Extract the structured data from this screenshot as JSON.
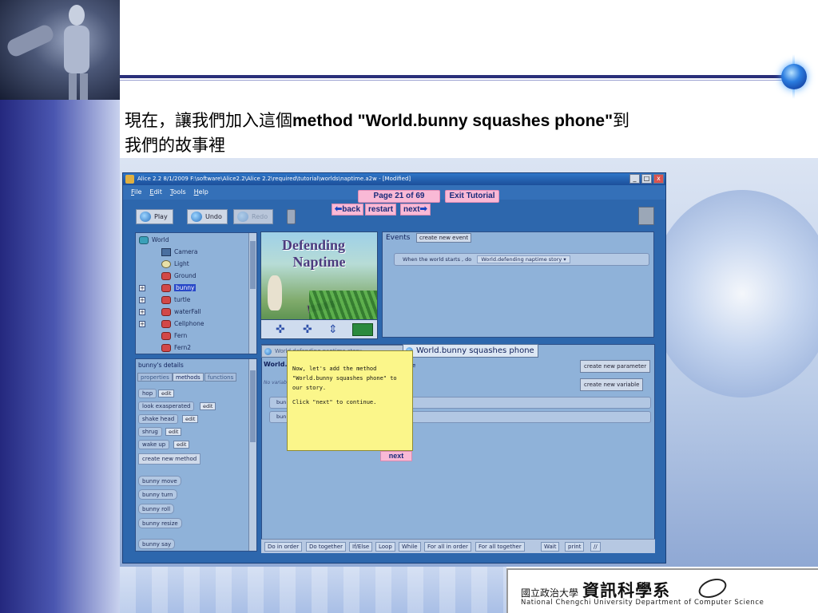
{
  "slide": {
    "title_zh_prefix": "現在，讓我們加入這個",
    "title_en": "method \"World.bunny squashes phone\"",
    "title_zh_suffix": "到",
    "title_line2": "我們的故事裡"
  },
  "logo": {
    "small": "國立政治大學",
    "big": "資訊科學系",
    "english": "National Chengchi University Department of Computer Science"
  },
  "window": {
    "title": "Alice 2.2 8/1/2009 F:\\software\\Alice2.2\\Alice 2.2\\required\\tutorial\\worlds\\naptime.a2w - [Modified]",
    "controls": [
      "_",
      "□",
      "x"
    ]
  },
  "menu": [
    "File",
    "Edit",
    "Tools",
    "Help"
  ],
  "tutorial": {
    "page": "Page 21 of 69",
    "exit": "Exit Tutorial",
    "back": "back",
    "restart": "restart",
    "next": "next"
  },
  "toolbar": {
    "play": "Play",
    "undo": "Undo",
    "redo": "Redo"
  },
  "object_tree": [
    {
      "label": "World",
      "kind": "world"
    },
    {
      "label": "Camera",
      "kind": "cam"
    },
    {
      "label": "Light",
      "kind": "bulb"
    },
    {
      "label": "Ground",
      "kind": "obj"
    },
    {
      "label": "bunny",
      "kind": "obj"
    },
    {
      "label": "turtle",
      "kind": "obj"
    },
    {
      "label": "waterFall",
      "kind": "obj"
    },
    {
      "label": "Cellphone",
      "kind": "obj"
    },
    {
      "label": "Fern",
      "kind": "obj"
    },
    {
      "label": "Fern2",
      "kind": "obj"
    }
  ],
  "scene": {
    "title_line1": "Defending",
    "title_line2": "Naptime"
  },
  "events": {
    "header": "Events",
    "create_button": "create new event",
    "row_text": "When the world starts , do",
    "row_value": "World.defending naptime story",
    "row_dropdown": "▾"
  },
  "details": {
    "header": "bunny's details",
    "tabs": [
      "properties",
      "methods",
      "functions"
    ],
    "methods": [
      "hop",
      "look exasperated",
      "shake head",
      "shrug",
      "wake up"
    ],
    "edit_label": "edit",
    "create_method": "create new method",
    "builtins": [
      "bunny  move",
      "bunny  turn",
      "bunny  roll",
      "bunny  resize",
      "bunny  say"
    ]
  },
  "editor": {
    "tab_inactive": "World.defending naptime story",
    "tab_active": "World.bunny squashes phone",
    "method_title": "World.",
    "params_hint": "No variables",
    "title_cut": "e",
    "rows": [
      "bun",
      "bun"
    ],
    "create_param": "create new parameter",
    "create_var": "create new variable"
  },
  "tooltip": {
    "line1": "Now, let's add the method \"World.bunny squashes phone\" to our story.",
    "line2": "Click \"next\" to continue.",
    "next": "next"
  },
  "control_bar": [
    "Do in order",
    "Do together",
    "If/Else",
    "Loop",
    "While",
    "For all in order",
    "For all together",
    "Wait",
    "print",
    "//"
  ]
}
